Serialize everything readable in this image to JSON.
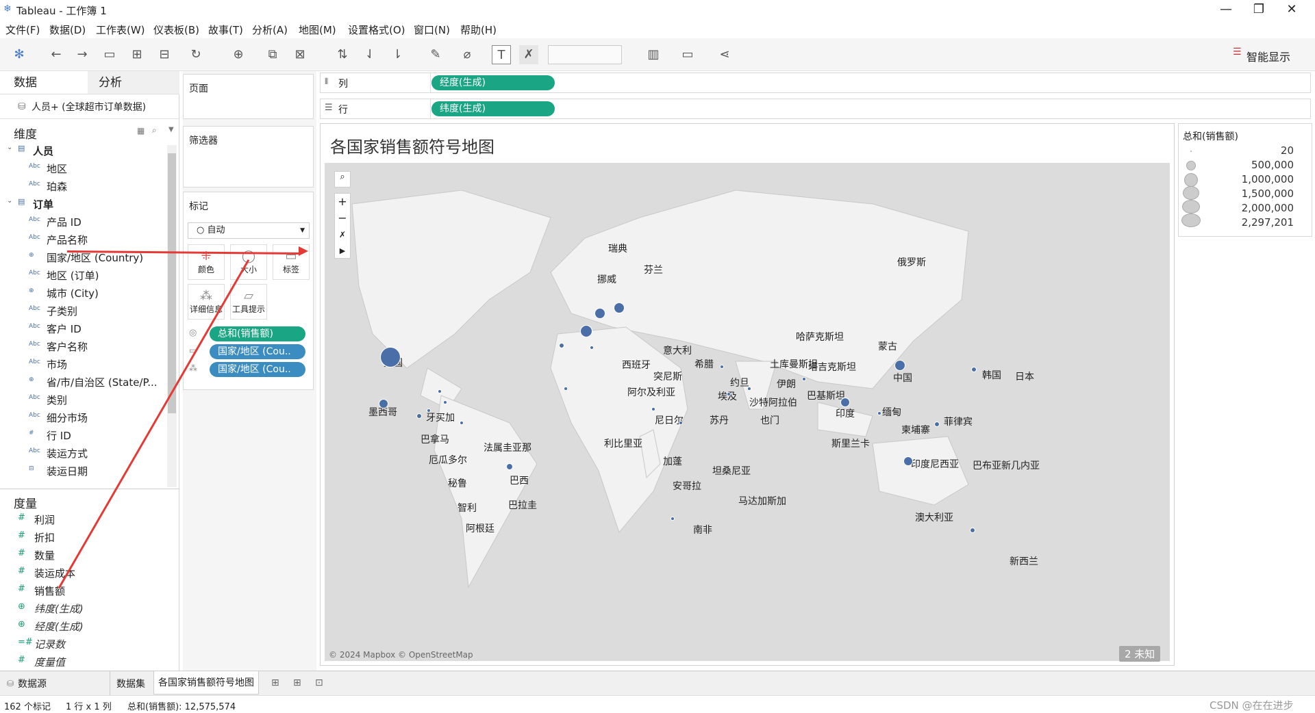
{
  "app": {
    "title": "Tableau - 工作簿 1",
    "min": "—",
    "max": "❐",
    "close": "✕"
  },
  "menu": [
    "文件(F)",
    "数据(D)",
    "工作表(W)",
    "仪表板(B)",
    "故事(T)",
    "分析(A)",
    "地图(M)",
    "设置格式(O)",
    "窗口(N)",
    "帮助(H)"
  ],
  "toolbar": {
    "show_me": "智能显示"
  },
  "left": {
    "tab_data": "数据",
    "tab_analysis": "分析",
    "datasource": "人员+ (全球超市订单数据)",
    "dimensions_title": "维度",
    "measures_title": "度量",
    "groups": [
      {
        "name": "人员",
        "fields": [
          {
            "t": "Abc",
            "n": "地区"
          },
          {
            "t": "Abc",
            "n": "珀森"
          }
        ]
      },
      {
        "name": "订单",
        "fields": [
          {
            "t": "Abc",
            "n": "产品 ID"
          },
          {
            "t": "Abc",
            "n": "产品名称"
          },
          {
            "t": "⊕",
            "n": "国家/地区 (Country)"
          },
          {
            "t": "Abc",
            "n": "地区 (订单)"
          },
          {
            "t": "⊕",
            "n": "城市 (City)"
          },
          {
            "t": "Abc",
            "n": "子类别"
          },
          {
            "t": "Abc",
            "n": "客户 ID"
          },
          {
            "t": "Abc",
            "n": "客户名称"
          },
          {
            "t": "Abc",
            "n": "市场"
          },
          {
            "t": "⊕",
            "n": "省/市/自治区 (State/P..."
          },
          {
            "t": "Abc",
            "n": "类别"
          },
          {
            "t": "Abc",
            "n": "细分市场"
          },
          {
            "t": "#",
            "n": "行 ID"
          },
          {
            "t": "Abc",
            "n": "装运方式"
          },
          {
            "t": "⊟",
            "n": "装运日期"
          }
        ]
      }
    ],
    "measures": [
      {
        "t": "#",
        "n": "利润",
        "i": false
      },
      {
        "t": "#",
        "n": "折扣",
        "i": false
      },
      {
        "t": "#",
        "n": "数量",
        "i": false
      },
      {
        "t": "#",
        "n": "装运成本",
        "i": false
      },
      {
        "t": "#",
        "n": "销售额",
        "i": false
      },
      {
        "t": "⊕",
        "n": "纬度(生成)",
        "i": true
      },
      {
        "t": "⊕",
        "n": "经度(生成)",
        "i": true
      },
      {
        "t": "=#",
        "n": "记录数",
        "i": true
      },
      {
        "t": "#",
        "n": "度量值",
        "i": true
      }
    ]
  },
  "shelves": {
    "pages": "页面",
    "filters": "筛选器",
    "marks": "标记",
    "mark_type": "自动",
    "color": "颜色",
    "size": "大小",
    "label": "标签",
    "detail": "详细信息",
    "tooltip": "工具提示",
    "pills": [
      "总和(销售额)",
      "国家/地区 (Cou..",
      "国家/地区 (Cou.."
    ],
    "columns_label": "列",
    "rows_label": "行",
    "columns_pill": "经度(生成)",
    "rows_pill": "纬度(生成)"
  },
  "viz": {
    "title": "各国家销售额符号地图",
    "attribution": "© 2024 Mapbox © OpenStreetMap",
    "unknown": "2 未知"
  },
  "legend": {
    "title": "总和(销售额)",
    "items": [
      "20",
      "500,000",
      "1,000,000",
      "1,500,000",
      "2,000,000",
      "2,297,201"
    ]
  },
  "tabs": {
    "datasource": "数据源",
    "sheets": [
      "数据集",
      "各国家销售额符号地图"
    ]
  },
  "status": {
    "marks": "162 个标记",
    "rowcol": "1 行 x 1 列",
    "sum": "总和(销售额): 12,575,574",
    "watermark": "CSDN @在在进步"
  },
  "countries": [
    "瑞典",
    "芬兰",
    "挪威",
    "俄罗斯",
    "哈萨克斯坦",
    "蒙古",
    "美国",
    "西班牙",
    "意大利",
    "希腊",
    "土库曼斯坦",
    "塔吉克斯坦",
    "中国",
    "韩国",
    "日本",
    "突尼斯",
    "伊朗",
    "阿尔及利亚",
    "约旦",
    "埃及",
    "巴基斯坦",
    "沙特阿拉伯",
    "墨西哥",
    "牙买加",
    "尼日尔",
    "苏丹",
    "也门",
    "印度",
    "缅甸",
    "菲律宾",
    "巴拿马",
    "利比里亚",
    "斯里兰卡",
    "柬埔寨",
    "法属圭亚那",
    "厄瓜多尔",
    "加蓬",
    "印度尼西亚",
    "巴布亚新几内亚",
    "巴西",
    "秘鲁",
    "坦桑尼亚",
    "安哥拉",
    "马达加斯加",
    "澳大利亚",
    "智利",
    "巴拉圭",
    "阿根廷",
    "南非",
    "新西兰"
  ]
}
